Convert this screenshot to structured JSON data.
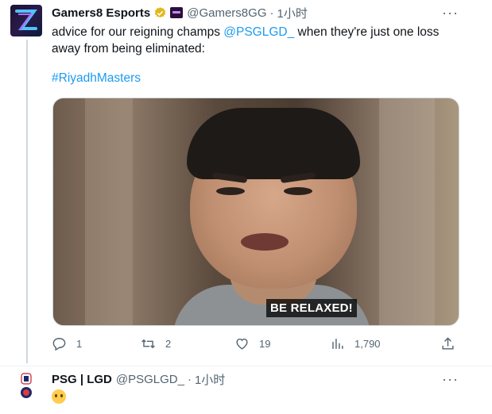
{
  "tweet": {
    "author_name": "Gamers8 Esports",
    "handle": "@Gamers8GG",
    "separator": "·",
    "time": "1小时",
    "more": "···",
    "text_prefix": "advice for our reigning champs ",
    "mention": "@PSGLGD_",
    "text_suffix": " when they're just one loss away from being eliminated:",
    "hashtag": "#RiyadhMasters",
    "video_caption": "BE RELAXED!",
    "replies": "1",
    "retweets": "2",
    "likes": "19",
    "views": "1,790"
  },
  "reply": {
    "author_name": "PSG | LGD",
    "handle": "@PSGLGD_",
    "separator": "·",
    "time": "1小时",
    "more": "···"
  },
  "colors": {
    "link": "#1d9bf0",
    "muted": "#536471",
    "text": "#0f1419"
  }
}
